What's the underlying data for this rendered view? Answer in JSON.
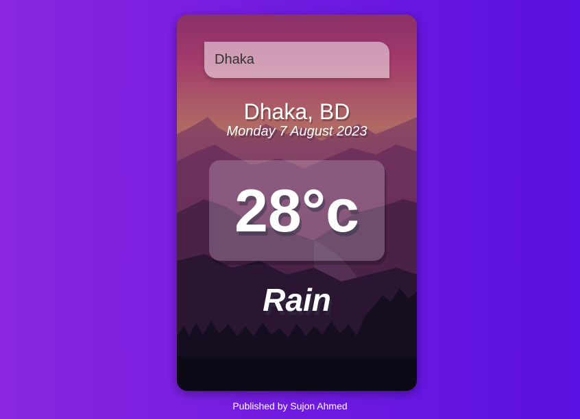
{
  "search": {
    "value": "Dhaka"
  },
  "location": "Dhaka, BD",
  "date": "Monday 7 August 2023",
  "temperature": "28°c",
  "weather": "Rain",
  "footer": "Published by Sujon Ahmed",
  "colors": {
    "background_start": "#8a26e0",
    "background_end": "#5a10e0",
    "card_sky_top": "#8c2f6a",
    "card_ground": "#0c0a18"
  }
}
